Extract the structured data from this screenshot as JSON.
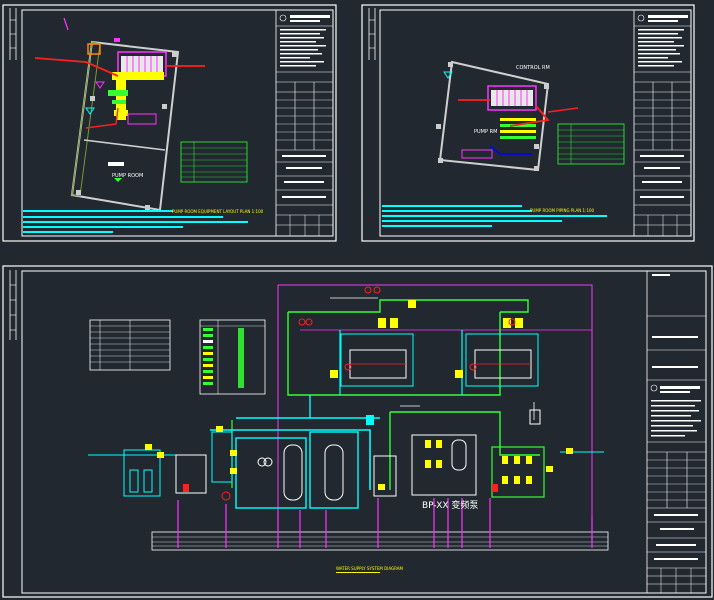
{
  "sheet1": {
    "room_label": "PUMP ROOM",
    "caption": "PUMP ROOM EQUIPMENT LAYOUT PLAN 1:100"
  },
  "sheet2": {
    "room_label_top": "CONTROL RM",
    "room_label_mid": "PUMP RM",
    "caption": "PUMP ROOM PIPING PLAN 1:100"
  },
  "sheet3": {
    "equipment_label": "BP-XX 变频泵",
    "caption": "WATER SUPPLY SYSTEM DIAGRAM"
  },
  "colors": {
    "background": "#212830",
    "frame": "#ffffff",
    "green": "#33ff33",
    "cyan": "#00ffff",
    "yellow": "#ffff00",
    "magenta": "#ff33ff",
    "red": "#ff2020"
  }
}
